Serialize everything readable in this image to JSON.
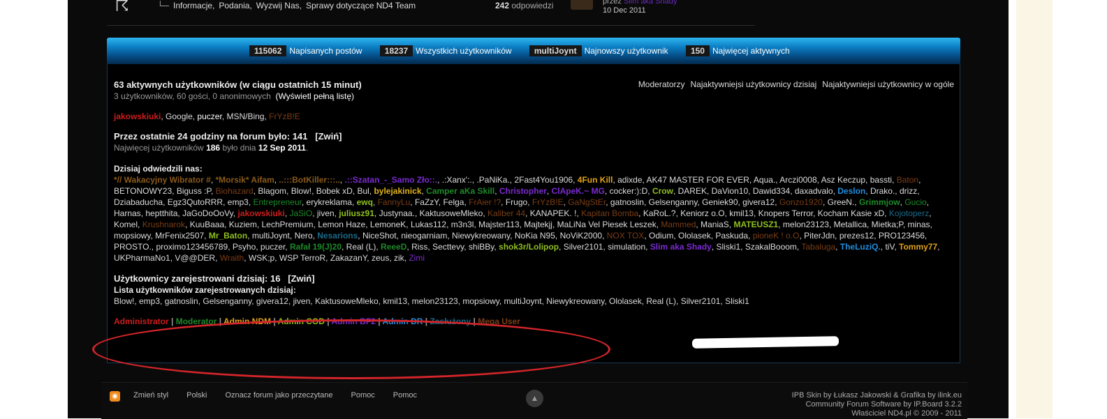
{
  "top": {
    "subforums": [
      "Informacje,",
      "Podania,",
      "Wyzwij Nas,",
      "Sprawy dotyczące ND4 Team"
    ],
    "replies_count": "242",
    "replies_label": "odpowiedzi",
    "lastpost_by": "przez",
    "lastpost_user": "Slim aka Shady",
    "lastpost_date": "10 Dec 2011"
  },
  "stats": [
    {
      "num": "115062",
      "label": "Napisanych postów"
    },
    {
      "num": "18237",
      "label": "Wszystkich użytkowników"
    },
    {
      "num": "multiJoynt",
      "label": "Najnowszy użytkownik"
    },
    {
      "num": "150",
      "label": "Najwięcej aktywnych"
    }
  ],
  "active": {
    "title": "63 aktywnych użytkowników (w ciągu ostatnich 15 minut)",
    "breakdown": "3 użytkowników, 60 gości, 0 anonimowych",
    "full_list": "(Wyświetl pełną listę)",
    "users": [
      {
        "name": "jakowskiuki",
        "color": "#cc1d1d",
        "bold": true
      },
      {
        "name": "Google",
        "color": "#dddddd",
        "bold": false
      },
      {
        "name": "puczer",
        "color": "#ffffff",
        "bold": false
      },
      {
        "name": "MSN/Bing",
        "color": "#dddddd",
        "bold": false
      },
      {
        "name": "FrYzB!E",
        "color": "#7a3d16",
        "bold": false
      }
    ]
  },
  "toplinks": [
    "Moderatorzy",
    "Najaktywniejsi użytkownicy dzisiaj",
    "Najaktywniejsi użytkownicy w ogóle"
  ],
  "last24": {
    "title": "Przez ostatnie 24 godziny na forum było: 141",
    "toggle": "[Zwiń]",
    "record_prefix": "Najwięcej użytkowników",
    "record_num": "186",
    "record_mid": "było dnia",
    "record_date": "12 Sep 2011",
    "record_end": "."
  },
  "visited": {
    "title": "Dzisiaj odwiedzili nas:",
    "users": [
      {
        "name": "*// Wakacyjny Wibrator #",
        "color": "#8a5a1a",
        "bold": true
      },
      {
        "name": "*Morsik* Aifam",
        "color": "#8a5a1a",
        "bold": true
      },
      {
        "name": "..:::BotKiller:::..",
        "color": "#8a5a1a",
        "bold": true
      },
      {
        "name": ".::Szatan_-_Samo Zło::.",
        "color": "#7b2bd1",
        "bold": true
      },
      {
        "name": ".:Xanx':.",
        "color": "#dddddd",
        "bold": false
      },
      {
        "name": ".PaNiKa.",
        "color": "#dddddd",
        "bold": false
      },
      {
        "name": "2Fast4You1906",
        "color": "#dddddd",
        "bold": false
      },
      {
        "name": "4Fun Kill",
        "color": "#e0a21a",
        "bold": true
      },
      {
        "name": "adixde",
        "color": "#dddddd",
        "bold": false
      },
      {
        "name": "AK47 MASTER FOR EVER",
        "color": "#dddddd",
        "bold": false
      },
      {
        "name": "Aqua.",
        "color": "#dddddd",
        "bold": false
      },
      {
        "name": "Arczi0008",
        "color": "#dddddd",
        "bold": false
      },
      {
        "name": "Asz Keczup",
        "color": "#dddddd",
        "bold": false
      },
      {
        "name": "bassti",
        "color": "#dddddd",
        "bold": false
      },
      {
        "name": "Baton",
        "color": "#7a3d16",
        "bold": false
      },
      {
        "name": "BETONOWY23",
        "color": "#dddddd",
        "bold": false
      },
      {
        "name": "Biguss :P",
        "color": "#dddddd",
        "bold": false
      },
      {
        "name": "Biohazard",
        "color": "#7a3d16",
        "bold": false
      },
      {
        "name": "Blagom",
        "color": "#dddddd",
        "bold": false
      },
      {
        "name": "Blow!",
        "color": "#dddddd",
        "bold": false
      },
      {
        "name": "Bobek xD",
        "color": "#dddddd",
        "bold": false
      },
      {
        "name": "Bul",
        "color": "#dddddd",
        "bold": false
      },
      {
        "name": "bylejakinick",
        "color": "#e0b21a",
        "bold": true
      },
      {
        "name": "Camper aKa Skill",
        "color": "#1e8a2a",
        "bold": true
      },
      {
        "name": "Christopher",
        "color": "#7b2bd1",
        "bold": true
      },
      {
        "name": "ClApeK.~ MG",
        "color": "#7b2bd1",
        "bold": true
      },
      {
        "name": "cocker:):D",
        "color": "#dddddd",
        "bold": false
      },
      {
        "name": "Crow",
        "color": "#8fbf1f",
        "bold": true
      },
      {
        "name": "DAREK",
        "color": "#dddddd",
        "bold": false
      },
      {
        "name": "DaVion10",
        "color": "#dddddd",
        "bold": false
      },
      {
        "name": "Dawid334",
        "color": "#dddddd",
        "bold": false
      },
      {
        "name": "daxadvalo",
        "color": "#dddddd",
        "bold": false
      },
      {
        "name": "Deslon",
        "color": "#1f8fe0",
        "bold": true
      },
      {
        "name": "Drako.",
        "color": "#dddddd",
        "bold": false
      },
      {
        "name": "drizz",
        "color": "#dddddd",
        "bold": false
      },
      {
        "name": "Dziabaducha",
        "color": "#dddddd",
        "bold": false
      },
      {
        "name": "Egz3QutoRRR",
        "color": "#dddddd",
        "bold": false
      },
      {
        "name": "emp3",
        "color": "#dddddd",
        "bold": false
      },
      {
        "name": "Entrepreneur",
        "color": "#1e8a2a",
        "bold": false
      },
      {
        "name": "erykreklama",
        "color": "#dddddd",
        "bold": false
      },
      {
        "name": "ewq",
        "color": "#8fbf1f",
        "bold": true
      },
      {
        "name": "FannyLu",
        "color": "#7a3d16",
        "bold": false
      },
      {
        "name": "FaZzY",
        "color": "#dddddd",
        "bold": false
      },
      {
        "name": "Felga",
        "color": "#dddddd",
        "bold": false
      },
      {
        "name": "FrAier !?",
        "color": "#7a3d16",
        "bold": false
      },
      {
        "name": "Frugo",
        "color": "#dddddd",
        "bold": false
      },
      {
        "name": "FrYzB!E",
        "color": "#7a3d16",
        "bold": false
      },
      {
        "name": "GaNgStEr",
        "color": "#7a3d16",
        "bold": false
      },
      {
        "name": "gatnoslin",
        "color": "#dddddd",
        "bold": false
      },
      {
        "name": "Gelsenganny",
        "color": "#dddddd",
        "bold": false
      },
      {
        "name": "Geniek90",
        "color": "#dddddd",
        "bold": false
      },
      {
        "name": "givera12",
        "color": "#dddddd",
        "bold": false
      },
      {
        "name": "Gonzo1920",
        "color": "#7a3d16",
        "bold": false
      },
      {
        "name": "GreeN.",
        "color": "#dddddd",
        "bold": false
      },
      {
        "name": "Grimmjow",
        "color": "#1e8a2a",
        "bold": true
      },
      {
        "name": "Gucio",
        "color": "#1e8a2a",
        "bold": false
      },
      {
        "name": "Harnas",
        "color": "#dddddd",
        "bold": false
      },
      {
        "name": "heptthita",
        "color": "#dddddd",
        "bold": false
      },
      {
        "name": "JaGoDoOoVy",
        "color": "#dddddd",
        "bold": false
      },
      {
        "name": "jakowskiuki",
        "color": "#cc1d1d",
        "bold": true
      },
      {
        "name": "JaSiO",
        "color": "#1e8a2a",
        "bold": false
      },
      {
        "name": "jiven",
        "color": "#dddddd",
        "bold": false
      },
      {
        "name": "juliusz91",
        "color": "#8fbf1f",
        "bold": true
      },
      {
        "name": "Justynaa.",
        "color": "#dddddd",
        "bold": false
      },
      {
        "name": "KaktusoweMleko",
        "color": "#dddddd",
        "bold": false
      },
      {
        "name": "Kaliber 44",
        "color": "#7a3d16",
        "bold": false
      },
      {
        "name": "KANAPEK. !",
        "color": "#dddddd",
        "bold": false
      },
      {
        "name": "Kapitan Bomba",
        "color": "#7a3d16",
        "bold": false
      },
      {
        "name": "KaRoL.?",
        "color": "#dddddd",
        "bold": false
      },
      {
        "name": "Keniorz o.O",
        "color": "#dddddd",
        "bold": false
      },
      {
        "name": "kmil13",
        "color": "#dddddd",
        "bold": false
      },
      {
        "name": "Knopers Terror",
        "color": "#dddddd",
        "bold": false
      },
      {
        "name": "Kocham Kasie xD",
        "color": "#dddddd",
        "bold": false
      },
      {
        "name": "Kojotoperz",
        "color": "#1a6a8a",
        "bold": false
      },
      {
        "name": "Komel",
        "color": "#dddddd",
        "bold": false
      },
      {
        "name": "Krushnarok",
        "color": "#7a3d16",
        "bold": false
      },
      {
        "name": "KuuBaaa",
        "color": "#dddddd",
        "bold": false
      },
      {
        "name": "Kuziem",
        "color": "#dddddd",
        "bold": false
      },
      {
        "name": "LechPremium",
        "color": "#dddddd",
        "bold": false
      },
      {
        "name": "Lemon Haze",
        "color": "#dddddd",
        "bold": false
      },
      {
        "name": "LemoneK",
        "color": "#dddddd",
        "bold": false
      },
      {
        "name": "Lukas112",
        "color": "#dddddd",
        "bold": false
      },
      {
        "name": "m3n3l",
        "color": "#dddddd",
        "bold": false
      },
      {
        "name": "Majster113",
        "color": "#dddddd",
        "bold": false
      },
      {
        "name": "Majtekjj",
        "color": "#dddddd",
        "bold": false
      },
      {
        "name": "MaLiNa Vel Piesek Leszek",
        "color": "#dddddd",
        "bold": false
      },
      {
        "name": "Mammed",
        "color": "#7a3d16",
        "bold": false
      },
      {
        "name": "ManiaS",
        "color": "#dddddd",
        "bold": false
      },
      {
        "name": "MATEUSZ1",
        "color": "#8fbf1f",
        "bold": true
      },
      {
        "name": "melon23123",
        "color": "#dddddd",
        "bold": false
      },
      {
        "name": "Metallica",
        "color": "#dddddd",
        "bold": false
      },
      {
        "name": "Mietka;P",
        "color": "#dddddd",
        "bold": false
      },
      {
        "name": "minas",
        "color": "#dddddd",
        "bold": false
      },
      {
        "name": "mopsiowy",
        "color": "#dddddd",
        "bold": false
      },
      {
        "name": "MrFenix2507",
        "color": "#dddddd",
        "bold": false
      },
      {
        "name": "Mr_Baton",
        "color": "#8fbf1f",
        "bold": true
      },
      {
        "name": "multiJoynt",
        "color": "#dddddd",
        "bold": false
      },
      {
        "name": "Nero",
        "color": "#dddddd",
        "bold": false
      },
      {
        "name": "Nesarions",
        "color": "#1a6a8a",
        "bold": true
      },
      {
        "name": "NiceShot",
        "color": "#dddddd",
        "bold": false
      },
      {
        "name": "nieogarniam",
        "color": "#dddddd",
        "bold": false
      },
      {
        "name": "Niewykreowany",
        "color": "#dddddd",
        "bold": false
      },
      {
        "name": "NoKia N95",
        "color": "#dddddd",
        "bold": false
      },
      {
        "name": "NoViK2000",
        "color": "#dddddd",
        "bold": false
      },
      {
        "name": "NOX TOX",
        "color": "#7a3d16",
        "bold": false
      },
      {
        "name": "Odium",
        "color": "#dddddd",
        "bold": false
      },
      {
        "name": "Ololasek",
        "color": "#dddddd",
        "bold": false
      },
      {
        "name": "Paskuda",
        "color": "#dddddd",
        "bold": false
      },
      {
        "name": "pioneK ! o.O",
        "color": "#7a3d16",
        "bold": false
      },
      {
        "name": "PiterJdn",
        "color": "#dddddd",
        "bold": false
      },
      {
        "name": "prezes12",
        "color": "#dddddd",
        "bold": false
      },
      {
        "name": "PRO123456",
        "color": "#dddddd",
        "bold": false
      },
      {
        "name": "PROSTO.",
        "color": "#dddddd",
        "bold": false
      },
      {
        "name": "proximo123456789",
        "color": "#dddddd",
        "bold": false
      },
      {
        "name": "Psyho",
        "color": "#dddddd",
        "bold": false
      },
      {
        "name": "puczer",
        "color": "#dddddd",
        "bold": false
      },
      {
        "name": "Rafał 19(J)20",
        "color": "#1e8a2a",
        "bold": true
      },
      {
        "name": "Real (L)",
        "color": "#dddddd",
        "bold": false
      },
      {
        "name": "ReeeD",
        "color": "#1e8a2a",
        "bold": true
      },
      {
        "name": "Riss",
        "color": "#dddddd",
        "bold": false
      },
      {
        "name": "Secttevy",
        "color": "#dddddd",
        "bold": false
      },
      {
        "name": "shiBBy",
        "color": "#dddddd",
        "bold": false
      },
      {
        "name": "shok3r/Lolipop",
        "color": "#8fbf1f",
        "bold": true
      },
      {
        "name": "Silver2101",
        "color": "#dddddd",
        "bold": false
      },
      {
        "name": "simulation",
        "color": "#dddddd",
        "bold": false
      },
      {
        "name": "Slim aka Shady",
        "color": "#7b2bd1",
        "bold": true
      },
      {
        "name": "Sliski1",
        "color": "#dddddd",
        "bold": false
      },
      {
        "name": "SzakalBooom",
        "color": "#dddddd",
        "bold": false
      },
      {
        "name": "Tabaluga",
        "color": "#7a3d16",
        "bold": false
      },
      {
        "name": "TheLuziQ.",
        "color": "#1f8fe0",
        "bold": true
      },
      {
        "name": "tiV",
        "color": "#dddddd",
        "bold": false
      },
      {
        "name": "Tommy77",
        "color": "#e0a21a",
        "bold": true
      },
      {
        "name": "UKPharmaNo1",
        "color": "#dddddd",
        "bold": false
      },
      {
        "name": "V@@DER",
        "color": "#dddddd",
        "bold": false
      },
      {
        "name": "Wraith",
        "color": "#7a3d16",
        "bold": false
      },
      {
        "name": "WSK;p",
        "color": "#dddddd",
        "bold": false
      },
      {
        "name": "WSP TerroR",
        "color": "#dddddd",
        "bold": false
      },
      {
        "name": "ZakazanY",
        "color": "#dddddd",
        "bold": false
      },
      {
        "name": "zeus",
        "color": "#dddddd",
        "bold": false
      },
      {
        "name": "zik",
        "color": "#dddddd",
        "bold": false
      },
      {
        "name": "Zimi",
        "color": "#7b2bd1",
        "bold": false
      }
    ]
  },
  "registered": {
    "title": "Użytkownicy zarejestrowani dzisiaj: 16",
    "toggle": "[Zwiń]",
    "list_title": "Lista użytkowników zarejestrowanych dzisiaj:",
    "list": "Blow!, emp3, gatnoslin, Gelsenganny, givera12, jiven, KaktusoweMleko, kmil13, melon23123, mopsiowy, multiJoynt, Niewykreowany, Ololasek, Real (L), Silver2101, Sliski1"
  },
  "legend": [
    {
      "label": "Administrator",
      "color": "#cc1d1d"
    },
    {
      "label": "Moderator",
      "color": "#1e8a2a"
    },
    {
      "label": "Admin NDM",
      "color": "#e0a21a"
    },
    {
      "label": "Admin COD",
      "color": "#8fbf1f"
    },
    {
      "label": "Admin BF2",
      "color": "#7b2bd1"
    },
    {
      "label": "Admin DR",
      "color": "#1f8fe0"
    },
    {
      "label": "Zasłużony",
      "color": "#1a6a8a"
    },
    {
      "label": "Mega User",
      "color": "#7a3d16"
    }
  ],
  "footer": {
    "links": [
      "Zmień styl",
      "Polski",
      "Oznacz forum jako przeczytane",
      "Pomoc",
      "Pomoc"
    ],
    "credit1": "IPB Skin by Łukasz Jakowski & Grafika by ilink.eu",
    "credit2": "Community Forum Software by IP.Board 3.2.2",
    "credit3": "Właściciel ND4.pl © 2009 - 2011"
  }
}
